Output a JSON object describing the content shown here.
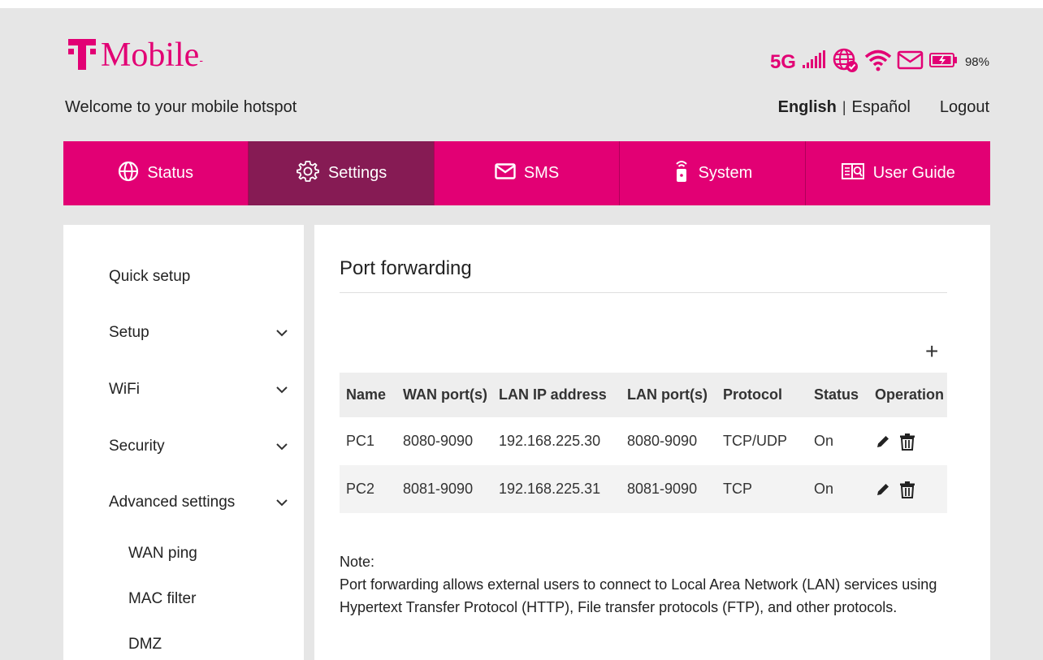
{
  "brand": {
    "name": "Mobile",
    "color": "#e20074",
    "dark_active": "#861b54"
  },
  "header": {
    "welcome": "Welcome to your mobile hotspot",
    "network": "5G",
    "battery_pct": "98%",
    "battery_level": 0.98,
    "icons": [
      "signal-bars-icon",
      "globe-connected-icon",
      "wifi-icon",
      "envelope-icon",
      "battery-charging-icon"
    ]
  },
  "lang": {
    "english": "English",
    "separator": "|",
    "spanish": "Español",
    "logout": "Logout"
  },
  "nav": [
    {
      "label": "Status",
      "icon": "globe-icon"
    },
    {
      "label": "Settings",
      "icon": "gear-icon",
      "active": true
    },
    {
      "label": "SMS",
      "icon": "envelope-icon"
    },
    {
      "label": "System",
      "icon": "router-icon"
    },
    {
      "label": "User Guide",
      "icon": "book-search-icon"
    }
  ],
  "sidebar": {
    "items": [
      {
        "label": "Quick setup"
      },
      {
        "label": "Setup"
      },
      {
        "label": "WiFi"
      },
      {
        "label": "Security"
      },
      {
        "label": "Advanced settings"
      }
    ],
    "sub_items": [
      {
        "label": "WAN ping"
      },
      {
        "label": "MAC filter"
      },
      {
        "label": "DMZ"
      }
    ]
  },
  "main": {
    "title": "Port forwarding",
    "add_label": "+",
    "columns": [
      "Name",
      "WAN port(s)",
      "LAN IP address",
      "LAN port(s)",
      "Protocol",
      "Status",
      "Operation"
    ],
    "rows": [
      {
        "name": "PC1",
        "wan": "8080-9090",
        "ip": "192.168.225.30",
        "lan": "8080-9090",
        "protocol": "TCP/UDP",
        "status": "On"
      },
      {
        "name": "PC2",
        "wan": "8081-9090",
        "ip": "192.168.225.31",
        "lan": "8081-9090",
        "protocol": "TCP",
        "status": "On"
      }
    ],
    "note_title": "Note:",
    "note_text": "Port forwarding allows external users to connect to Local Area Network (LAN) services using Hypertext Transfer Protocol (HTTP), File transfer protocols (FTP), and other protocols."
  }
}
